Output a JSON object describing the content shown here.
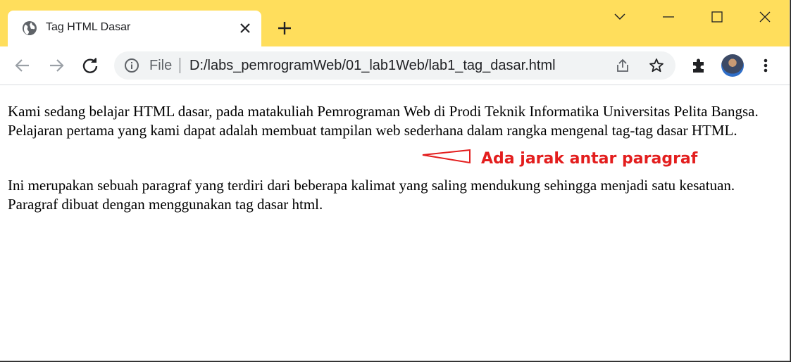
{
  "tab": {
    "title": "Tag HTML Dasar",
    "favicon": "globe-icon",
    "close_icon": "close-icon"
  },
  "new_tab_icon": "plus-icon",
  "window_controls": [
    "chevron-down-icon",
    "minimize-icon",
    "maximize-icon",
    "close-icon"
  ],
  "toolbar": {
    "back_icon": "arrow-left-icon",
    "forward_icon": "arrow-right-icon",
    "reload_icon": "reload-icon",
    "omnibox": {
      "info_icon": "info-icon",
      "scheme_label": "File",
      "url": "D:/labs_pemrogramWeb/01_lab1Web/lab1_tag_dasar.html",
      "share_icon": "share-icon",
      "bookmark_icon": "star-icon"
    },
    "extensions_icon": "puzzle-icon",
    "profile": "avatar",
    "menu_icon": "kebab-menu-icon"
  },
  "page": {
    "paragraph_1": "Kami sedang belajar HTML dasar, pada matakuliah Pemrograman Web di Prodi Teknik Informatika Universitas Pelita Bangsa. Pelajaran pertama yang kami dapat adalah membuat tampilan web sederhana dalam rangka mengenal tag-tag dasar HTML.",
    "paragraph_2": "Ini merupakan sebuah paragraf yang terdiri dari beberapa kalimat yang saling mendukung sehingga menjadi satu kesatuan. Paragraf dibuat dengan menggunakan tag dasar html."
  },
  "annotation": {
    "text": "Ada jarak antar paragraf",
    "color": "#e31e1e"
  },
  "colors": {
    "tabstrip": "#ffde5c",
    "toolbar": "#ffffff",
    "omnibox": "#f1f3f4"
  }
}
